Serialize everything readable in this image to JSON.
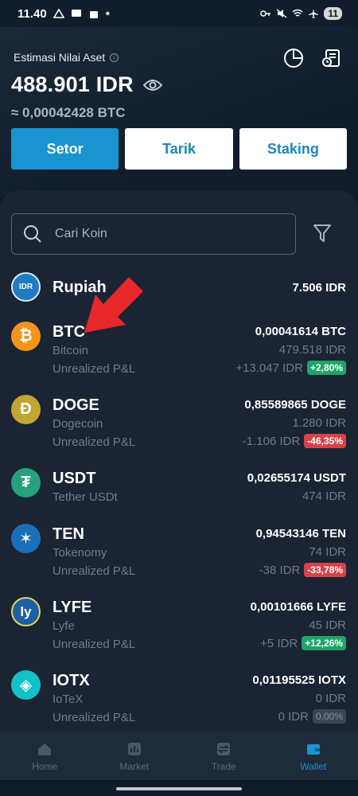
{
  "status_bar": {
    "time": "11.40",
    "battery": "11"
  },
  "header": {
    "estimate_label": "Estimasi Nilai Aset",
    "balance_idr": "488.901 IDR",
    "balance_btc": "≈ 0,00042428 BTC"
  },
  "actions": {
    "deposit_label": "Setor",
    "withdraw_label": "Tarik",
    "staking_label": "Staking"
  },
  "search": {
    "placeholder": "Cari Koin"
  },
  "pnl_label": "Unrealized P&L",
  "coins": [
    {
      "symbol": "Rupiah",
      "name": "",
      "amount": "7.506 IDR",
      "value": "",
      "pnl": "",
      "pnl_pct": "",
      "icon": "IDR",
      "icon_color": "#1e7cc2"
    },
    {
      "symbol": "BTC",
      "name": "Bitcoin",
      "amount": "0,00041614 BTC",
      "value": "479.518 IDR",
      "pnl": "+13.047 IDR",
      "pnl_pct": "+2,80%",
      "icon": "₿",
      "icon_color": "#f7931a"
    },
    {
      "symbol": "DOGE",
      "name": "Dogecoin",
      "amount": "0,85589865 DOGE",
      "value": "1.280 IDR",
      "pnl": "-1.106 IDR",
      "pnl_pct": "-46,35%",
      "icon": "Ð",
      "icon_color": "#c2a633"
    },
    {
      "symbol": "USDT",
      "name": "Tether USDt",
      "amount": "0,02655174 USDT",
      "value": "474 IDR",
      "pnl": "",
      "pnl_pct": "",
      "icon": "₮",
      "icon_color": "#26a17b"
    },
    {
      "symbol": "TEN",
      "name": "Tokenomy",
      "amount": "0,94543146 TEN",
      "value": "74 IDR",
      "pnl": "-38 IDR",
      "pnl_pct": "-33,78%",
      "icon": "✶",
      "icon_color": "#1b6fb8"
    },
    {
      "symbol": "LYFE",
      "name": "Lyfe",
      "amount": "0,00101666 LYFE",
      "value": "45 IDR",
      "pnl": "+5 IDR",
      "pnl_pct": "+12,26%",
      "icon": "ly",
      "icon_color": "#1d5fa6"
    },
    {
      "symbol": "IOTX",
      "name": "IoTeX",
      "amount": "0,01195525 IOTX",
      "value": "0 IDR",
      "pnl": "0 IDR",
      "pnl_pct": "0,00%",
      "icon": "◈",
      "icon_color": "#12c2c8"
    }
  ],
  "nav": {
    "home": "Home",
    "market": "Market",
    "trade": "Trade",
    "wallet": "Wallet"
  },
  "colors": {
    "accent": "#1a93d1",
    "positive": "#1fa56a",
    "negative": "#d7434b"
  }
}
